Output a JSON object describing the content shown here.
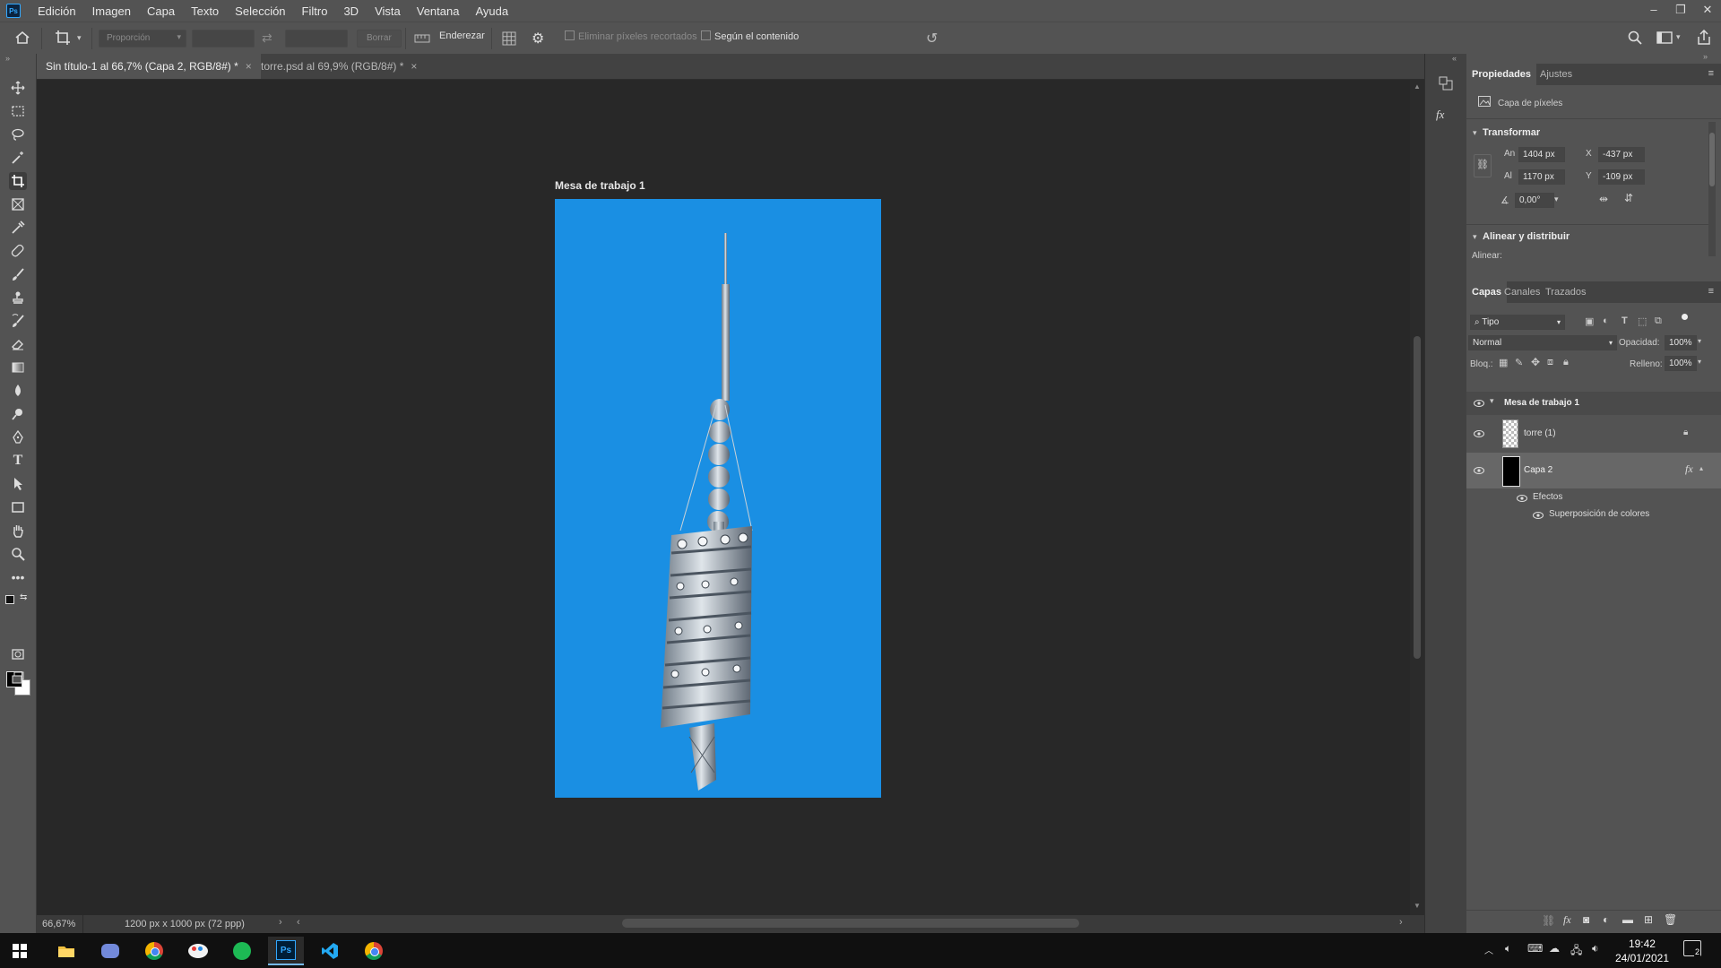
{
  "app": {
    "logo": "Ps"
  },
  "menu": [
    "Edición",
    "Imagen",
    "Capa",
    "Texto",
    "Selección",
    "Filtro",
    "3D",
    "Vista",
    "Ventana",
    "Ayuda"
  ],
  "window_controls": {
    "minimize": "–",
    "restore": "❐",
    "close": "✕"
  },
  "options_bar": {
    "ratio_select": "Proporción",
    "clear_button": "Borrar",
    "straighten_label": "Enderezar",
    "delete_cropped_label": "Eliminar píxeles recortados",
    "content_aware_label": "Según el contenido"
  },
  "tabs": [
    {
      "label": "Sin título-1 al 66,7% (Capa 2, RGB/8#) *",
      "close": "×"
    },
    {
      "label": "torre.psd al 69,9% (RGB/8#) *",
      "close": "×"
    }
  ],
  "canvas": {
    "artboard_label": "Mesa de trabajo 1",
    "artboard_color": "#1a8fe3"
  },
  "status": {
    "zoom": "66,67%",
    "doc_info": "1200 px x 1000 px (72 ppp)"
  },
  "properties": {
    "tabs": [
      "Propiedades",
      "Ajustes"
    ],
    "layer_kind": "Capa de píxeles",
    "transform_header": "Transformar",
    "width_label": "An",
    "width": "1404 px",
    "height_label": "Al",
    "height": "1170 px",
    "x_label": "X",
    "x": "-437 px",
    "y_label": "Y",
    "y": "-109 px",
    "angle": "0,00°",
    "align_header": "Alinear y distribuir",
    "align_label": "Alinear:"
  },
  "layers_panel": {
    "tabs": [
      "Capas",
      "Canales",
      "Trazados"
    ],
    "filter": "Tipo",
    "blend_mode": "Normal",
    "opacity_label": "Opacidad:",
    "opacity": "100%",
    "lock_label": "Bloq.:",
    "fill_label": "Relleno:",
    "fill": "100%",
    "layers": [
      {
        "name": "Mesa de trabajo 1",
        "type": "artboard"
      },
      {
        "name": "torre (1)",
        "type": "pixel",
        "locked": true
      },
      {
        "name": "Capa 2",
        "type": "pixel",
        "selected": true,
        "fx": "fx"
      }
    ],
    "effects_label": "Efectos",
    "effect_item": "Superposición de colores"
  },
  "taskbar": {
    "time": "19:42",
    "date": "24/01/2021",
    "notifications": "2"
  }
}
